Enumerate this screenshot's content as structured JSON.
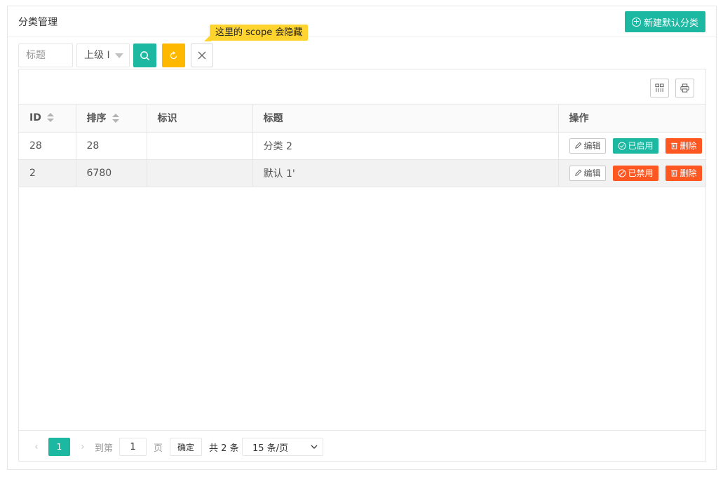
{
  "panel": {
    "title": "分类管理",
    "new_button": "新建默认分类"
  },
  "tooltip": "这里的 scope 会隐藏",
  "search": {
    "title_placeholder": "标题",
    "parent_label": "上级 I"
  },
  "table": {
    "headers": {
      "id": "ID",
      "sort": "排序",
      "key": "标识",
      "title": "标题",
      "ops": "操作"
    },
    "rows": [
      {
        "id": "28",
        "sort": "28",
        "key": "",
        "title": "分类 2",
        "status_label": "已启用",
        "status": "enabled"
      },
      {
        "id": "2",
        "sort": "6780",
        "key": "",
        "title": "默认 1'",
        "status_label": "已禁用",
        "status": "disabled"
      }
    ],
    "edit_label": "编辑",
    "delete_label": "删除"
  },
  "pager": {
    "prev": "‹",
    "current": "1",
    "next": "›",
    "goto": "到第",
    "page_input": "1",
    "page_unit": "页",
    "confirm": "确定",
    "total": "共 2 条",
    "page_size": "15 条/页"
  },
  "colors": {
    "primary": "#1cb8a2",
    "warn": "#ffb800",
    "danger": "#ff5722",
    "tooltip": "#ffd42e"
  }
}
